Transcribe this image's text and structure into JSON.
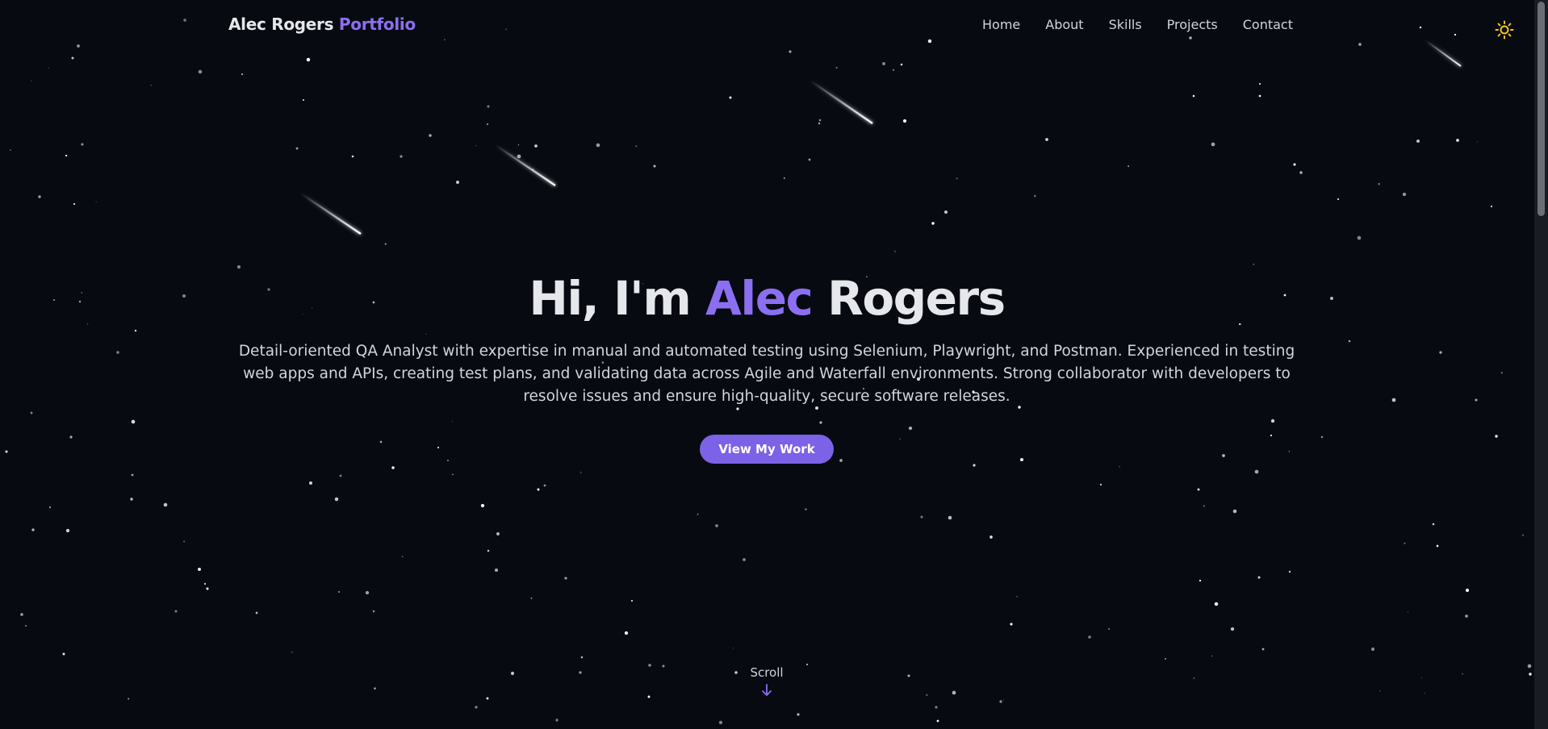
{
  "navbar": {
    "brand_name": "Alec Rogers",
    "brand_suffix": "Portfolio",
    "links": [
      "Home",
      "About",
      "Skills",
      "Projects",
      "Contact"
    ],
    "theme_toggle_icon": "sun-icon"
  },
  "hero": {
    "greeting": "Hi, I'm",
    "first_name": "Alec",
    "last_name": "Rogers",
    "description": "Detail-oriented QA Analyst with expertise in manual and automated testing using Selenium, Playwright, and Postman. Experienced in testing web apps and APIs, creating test plans, and validating data across Agile and Waterfall environments. Strong collaborator with developers to resolve issues and ensure high-quality, secure software releases.",
    "cta_label": "View My Work"
  },
  "scroll_hint": {
    "label": "Scroll",
    "icon": "arrow-down-icon"
  },
  "colors": {
    "background": "#080a12",
    "accent": "#8b6ff0",
    "button": "#7c62e6",
    "sun": "#f5c518",
    "text": "#e5e7eb"
  }
}
